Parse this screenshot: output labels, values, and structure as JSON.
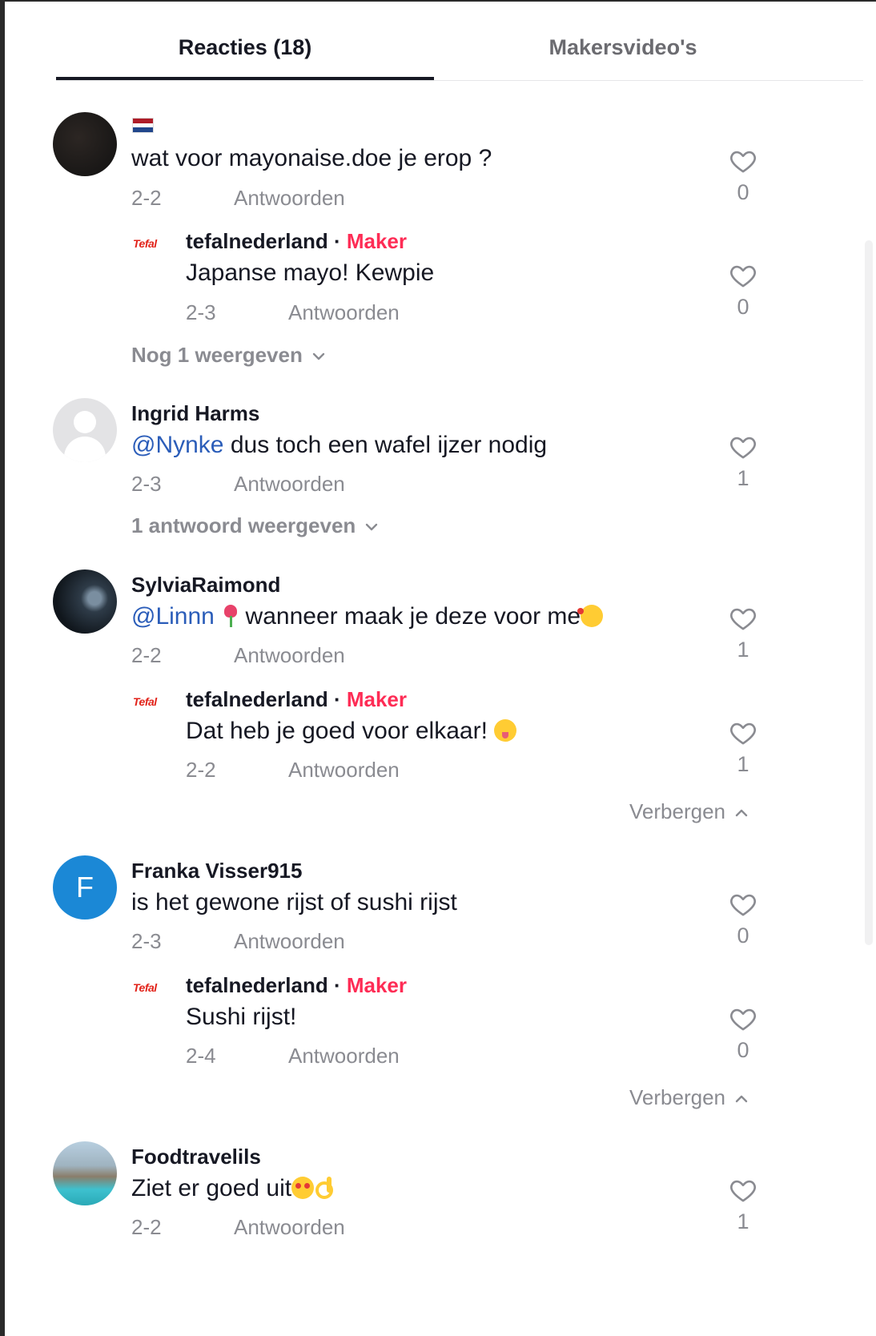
{
  "tabs": [
    {
      "label": "Reacties (18)",
      "active": true
    },
    {
      "label": "Makersvideo's",
      "active": false
    }
  ],
  "reply_label": "Antwoorden",
  "maker_label": "Maker",
  "comments": [
    {
      "username": "",
      "text": "wat voor mayonaise.doe je erop ?",
      "date": "2-2",
      "likes": "0",
      "replies": [
        {
          "username": "tefalnederland",
          "text": "Japanse mayo! Kewpie",
          "date": "2-3",
          "likes": "0"
        }
      ],
      "expand_label": "Nog 1 weergeven"
    },
    {
      "username": "Ingrid Harms",
      "mention": "@Nynke",
      "text": "dus toch een wafel ijzer nodig",
      "date": "2-3",
      "likes": "1",
      "expand_label": "1 antwoord weergeven"
    },
    {
      "username": "SylviaRaimond",
      "mention": "@Linnn",
      "text": "wanneer maak je deze voor me",
      "date": "2-2",
      "likes": "1",
      "replies": [
        {
          "username": "tefalnederland",
          "text": "Dat heb je goed voor elkaar!",
          "date": "2-2",
          "likes": "1"
        }
      ],
      "expand_label": "Verbergen"
    },
    {
      "username": "Franka Visser915",
      "avatar_letter": "F",
      "text": "is het gewone rijst of sushi rijst",
      "date": "2-3",
      "likes": "0",
      "replies": [
        {
          "username": "tefalnederland",
          "text": "Sushi rijst!",
          "date": "2-4",
          "likes": "0"
        }
      ],
      "expand_label": "Verbergen"
    },
    {
      "username": "Foodtravelils",
      "text": "Ziet er goed uit",
      "date": "2-2",
      "likes": "1"
    }
  ],
  "logo_text": "Tefal",
  "colors": {
    "maker": "#fe2c55",
    "mention": "#2b5db9",
    "meta": "#8a8b91",
    "avatar_letter_bg": "#1b88d6"
  },
  "icons": {
    "like": "heart-outline-icon",
    "expand": "chevron-down-icon",
    "collapse": "chevron-up-icon"
  }
}
